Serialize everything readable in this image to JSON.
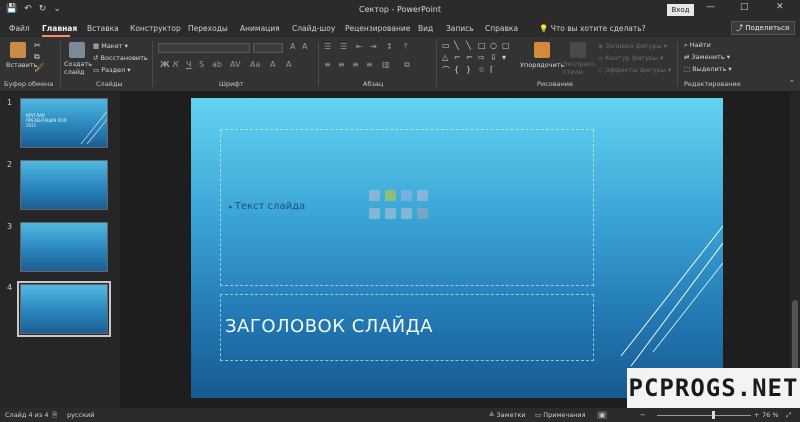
{
  "window": {
    "title": "Сектор  -  PowerPoint",
    "login_label": "Вход",
    "controls": [
      "—",
      "□",
      "✕"
    ]
  },
  "qat": {
    "save": "💾",
    "undo": "↶",
    "redo": "↻",
    "customize": "⌄"
  },
  "tabs": [
    {
      "label": "Файл"
    },
    {
      "label": "Главная"
    },
    {
      "label": "Вставка"
    },
    {
      "label": "Конструктор"
    },
    {
      "label": "Переходы"
    },
    {
      "label": "Анимация"
    },
    {
      "label": "Слайд-шоу"
    },
    {
      "label": "Рецензирование"
    },
    {
      "label": "Вид"
    },
    {
      "label": "Запись"
    },
    {
      "label": "Справка"
    }
  ],
  "tell_me": "Что вы хотите сделать?",
  "share_label": "Поделиться",
  "ribbon": {
    "clipboard": {
      "paste": "Вставить",
      "group": "Буфер обмена"
    },
    "slides": {
      "new_slide": "Создать слайд",
      "layout": "Макет",
      "reset": "Восстановить",
      "section": "Раздел",
      "group": "Слайды"
    },
    "font": {
      "group": "Шрифт"
    },
    "paragraph": {
      "group": "Абзац"
    },
    "drawing": {
      "arrange": "Упорядочить",
      "quick_styles": "Экспресс-стили",
      "fill": "Заливка фигуры",
      "outline": "Контур фигуры",
      "effects": "Эффекты фигуры",
      "group": "Рисование"
    },
    "editing": {
      "find": "Найти",
      "replace": "Заменить",
      "select": "Выделить",
      "group": "Редактирование"
    }
  },
  "thumbnails": [
    {
      "number": "1",
      "title": "КРУГЛАЯ ПРЕЗЕНТАЦИЯ ЛОЛ 2021"
    },
    {
      "number": "2"
    },
    {
      "number": "3"
    },
    {
      "number": "4"
    }
  ],
  "slide": {
    "body_placeholder": "Текст слайда",
    "title_placeholder": "ЗАГОЛОВОК СЛАЙДА"
  },
  "status": {
    "slide_counter": "Слайд 4 из 4",
    "language": "русский",
    "notes": "Заметки",
    "comments": "Примечания",
    "zoom": "76 %",
    "zoom_level_percent": 76
  },
  "watermark": "PCPROGS.NET"
}
